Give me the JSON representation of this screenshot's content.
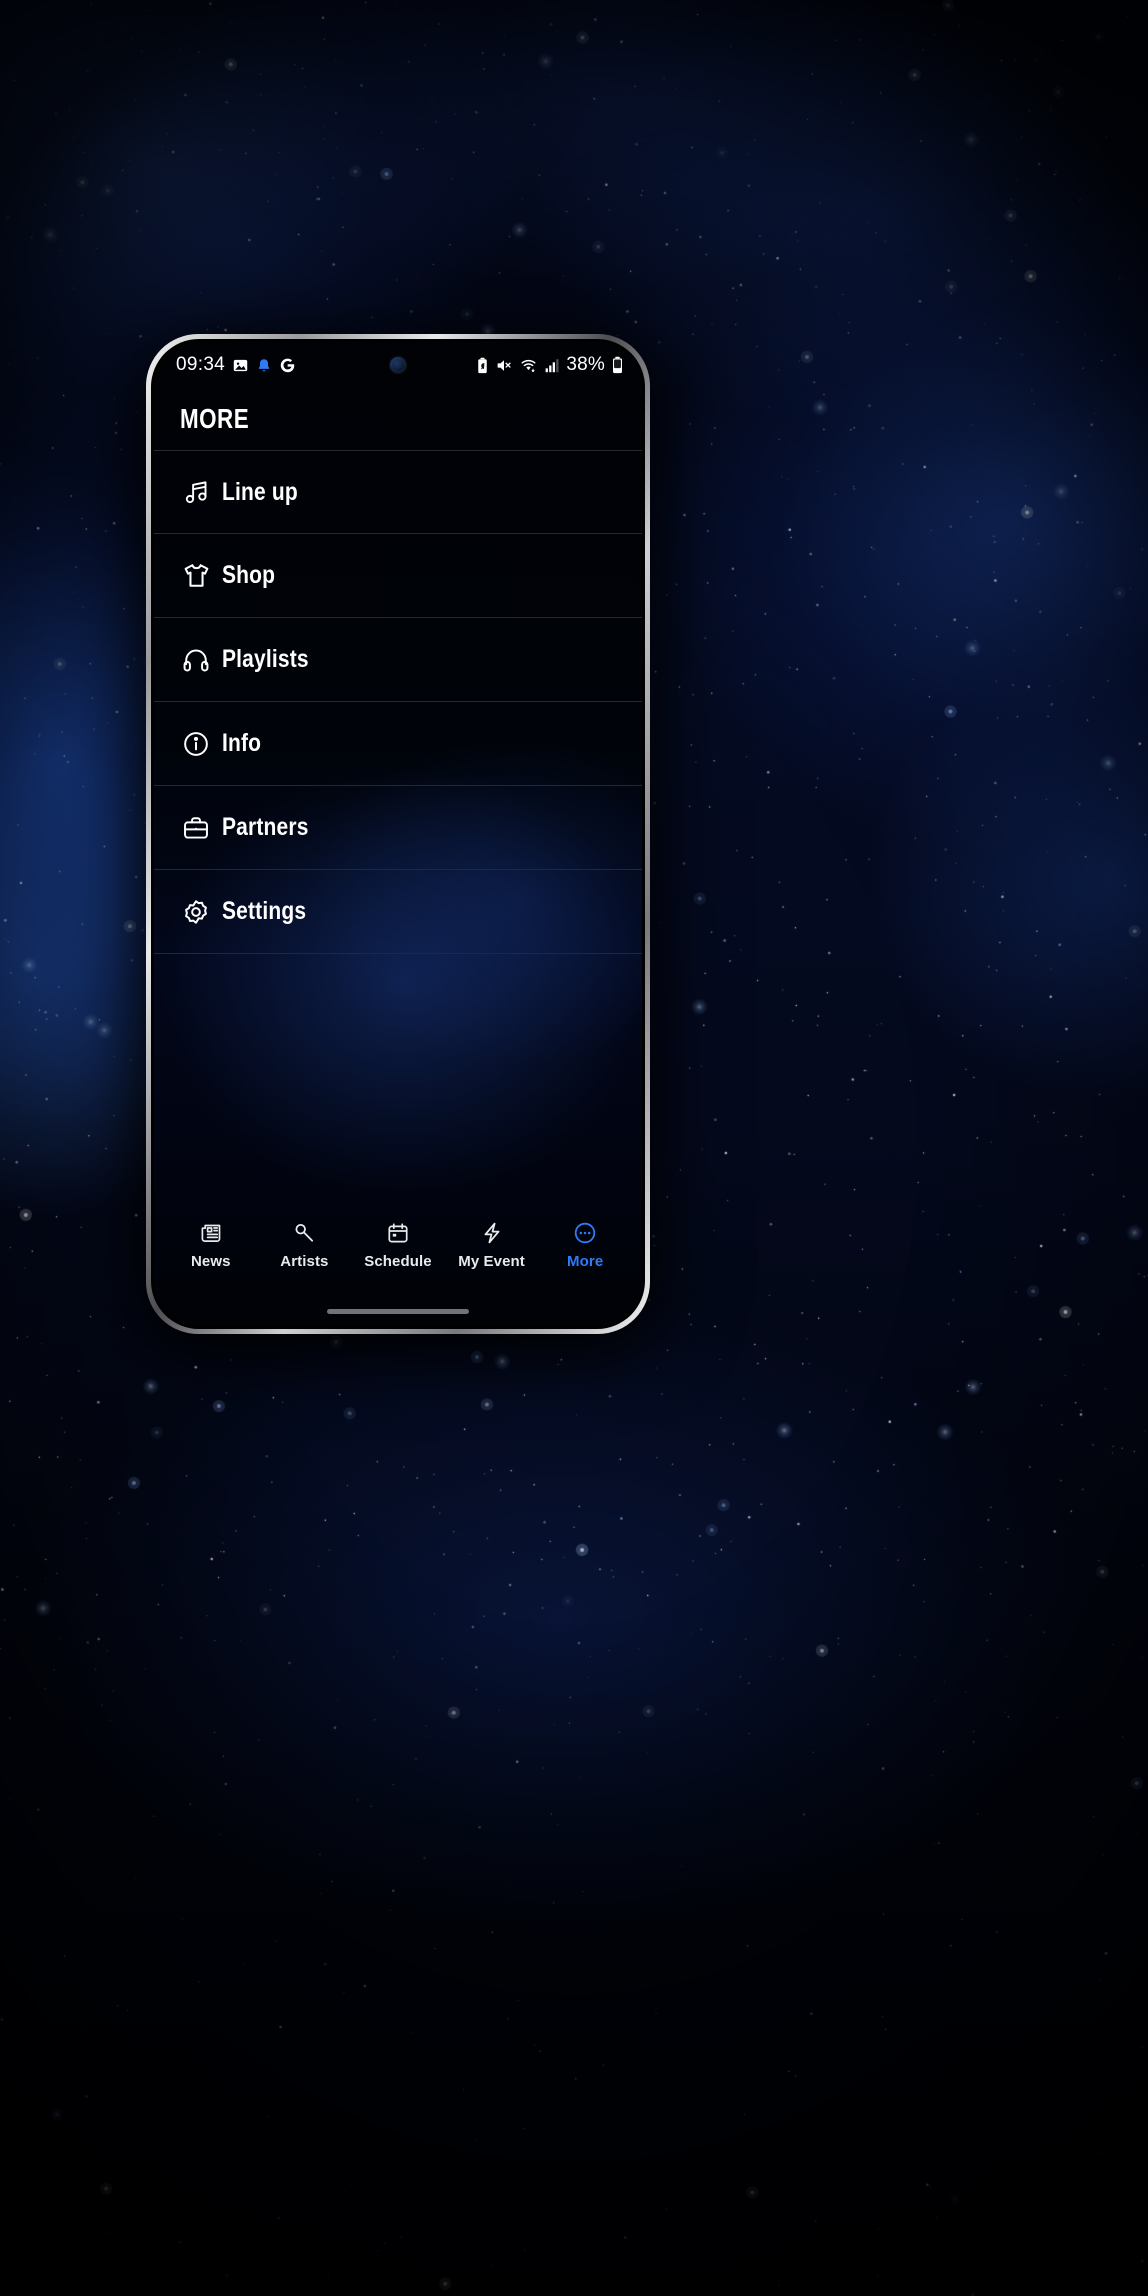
{
  "wallpaper": {
    "name": "starfield-nebula",
    "base_color": "#04091d",
    "nebula_color": "#2656be"
  },
  "device": {
    "name": "android-phone",
    "frame_color": "#c9c9cd"
  },
  "status_bar": {
    "time": "09:34",
    "battery_percent": "38%",
    "left_icons": [
      {
        "name": "image-icon",
        "glyph": "image"
      },
      {
        "name": "notification-bell-icon",
        "glyph": "bell",
        "color": "#2f7bf6"
      },
      {
        "name": "google-icon",
        "glyph": "G"
      }
    ],
    "right_icons": [
      {
        "name": "battery-saver-icon",
        "glyph": "battery-leaf"
      },
      {
        "name": "mute-icon",
        "glyph": "speaker-muted"
      },
      {
        "name": "wifi-icon",
        "glyph": "wifi"
      },
      {
        "name": "cellular-signal-icon",
        "glyph": "signal-bars"
      },
      {
        "name": "battery-icon",
        "glyph": "battery"
      }
    ]
  },
  "header": {
    "title": "MORE"
  },
  "menu": {
    "items": [
      {
        "label": "Line up",
        "icon": "music-note-icon"
      },
      {
        "label": "Shop",
        "icon": "tshirt-icon"
      },
      {
        "label": "Playlists",
        "icon": "headphones-icon"
      },
      {
        "label": "Info",
        "icon": "info-circle-icon"
      },
      {
        "label": "Partners",
        "icon": "briefcase-icon"
      },
      {
        "label": "Settings",
        "icon": "gear-icon"
      }
    ]
  },
  "bottom_nav": {
    "active_color": "#2f7bf6",
    "inactive_color": "#e9eaec",
    "items": [
      {
        "label": "News",
        "icon": "newspaper-icon",
        "active": false
      },
      {
        "label": "Artists",
        "icon": "microphone-icon",
        "active": false
      },
      {
        "label": "Schedule",
        "icon": "calendar-icon",
        "active": false
      },
      {
        "label": "My Event",
        "icon": "lightning-icon",
        "active": false
      },
      {
        "label": "More",
        "icon": "more-circle-icon",
        "active": true
      }
    ]
  }
}
